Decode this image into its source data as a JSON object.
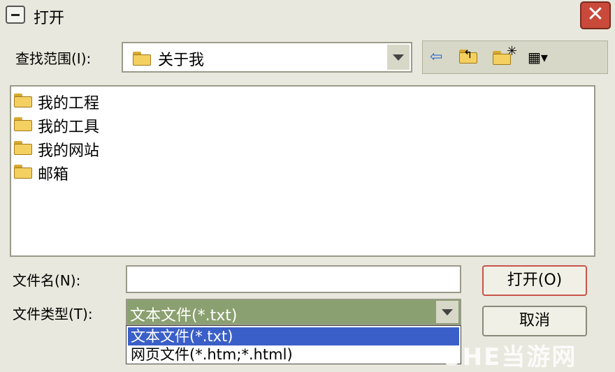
{
  "dialog": {
    "title": "打开"
  },
  "lookin": {
    "label": "查找范围(I):",
    "value": "关于我"
  },
  "files": [
    "我的工程",
    "我的工具",
    "我的网站",
    "邮箱"
  ],
  "filename": {
    "label": "文件名(N):",
    "value": ""
  },
  "filetype": {
    "label": "文件类型(T):",
    "value": "文本文件(*.txt)",
    "options": [
      "文本文件(*.txt)",
      "网页文件(*.htm;*.html)"
    ]
  },
  "buttons": {
    "open": "打开(O)",
    "cancel": "取消"
  },
  "watermark": "3HE当游网",
  "colors": {
    "selection": "#3a5fc8",
    "close": "#c94a3a",
    "type_field": "#8aa070"
  }
}
